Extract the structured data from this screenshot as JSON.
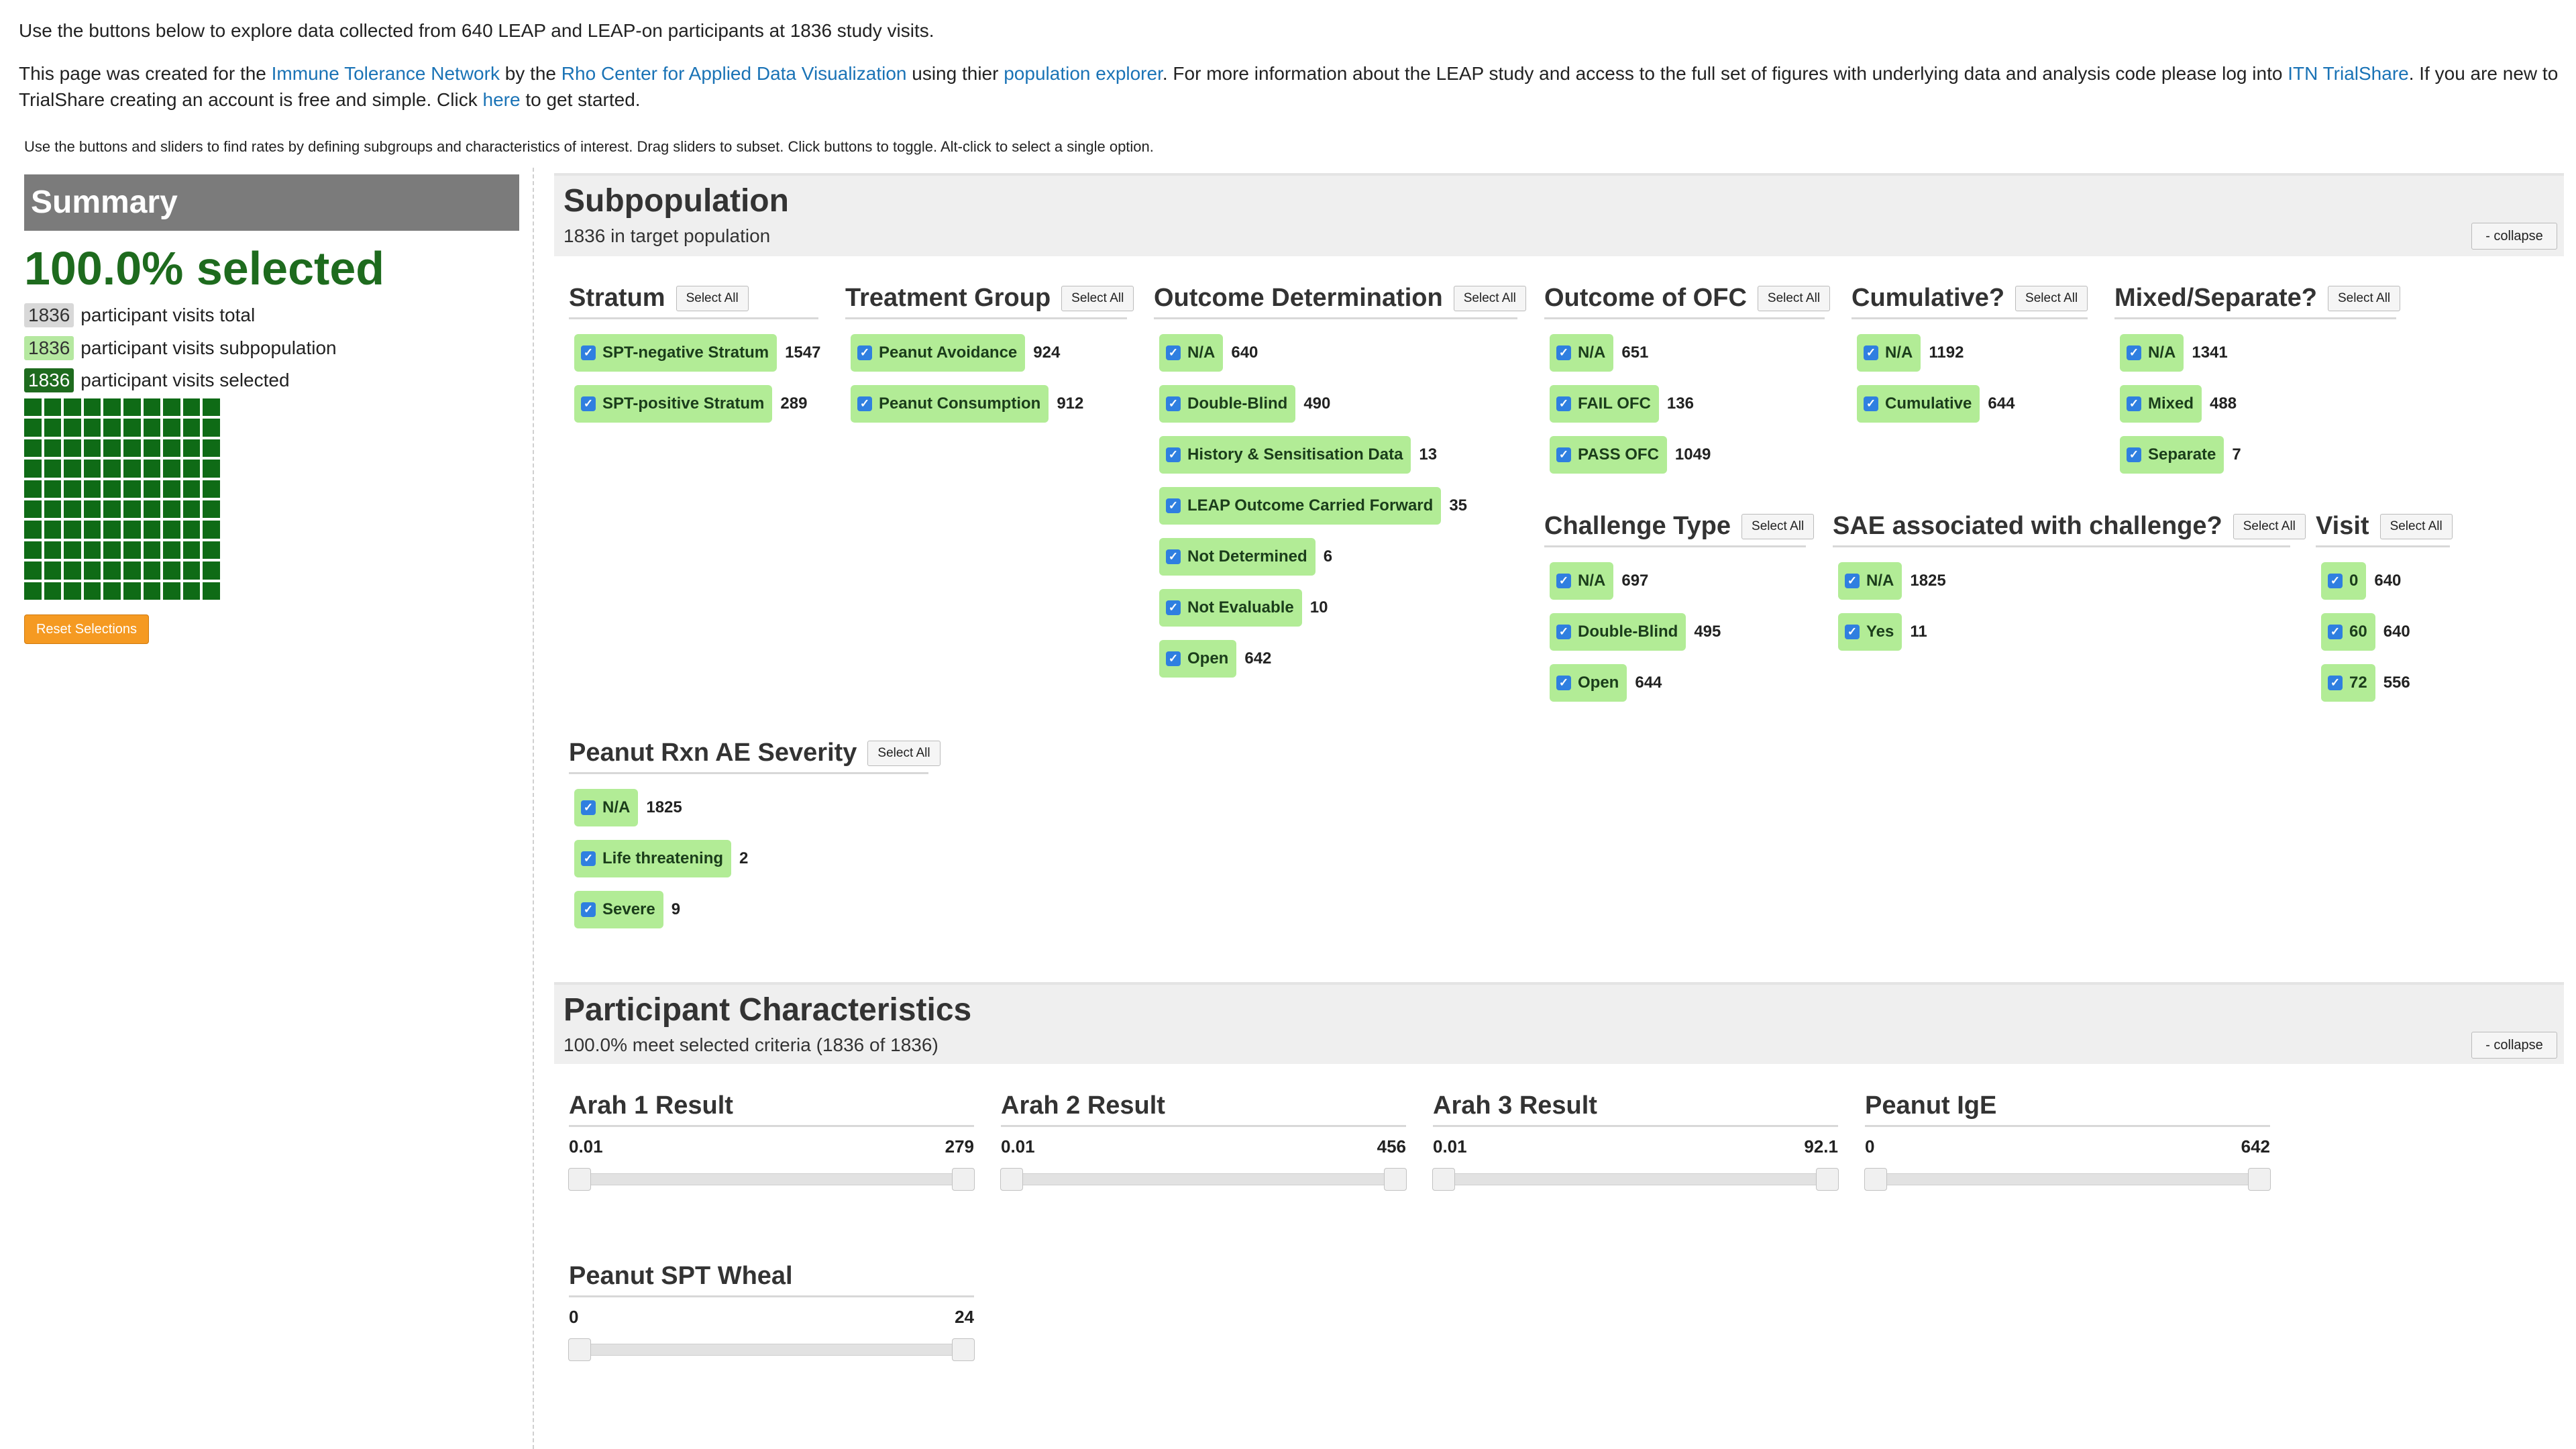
{
  "intro": {
    "line1": "Use the buttons below to explore data collected from 640 LEAP and LEAP-on participants at 1836 study visits.",
    "p2_a": "This page was created for the ",
    "link_itn": "Immune Tolerance Network",
    "p2_b": " by the ",
    "link_rho": "Rho Center for Applied Data Visualization",
    "p2_c": " using thier ",
    "link_pe": "population explorer",
    "p2_d": ". For more information about the LEAP study and access to the full set of figures with underlying data and analysis code please log into ",
    "link_trialshare": "ITN TrialShare",
    "p2_e": ". If you are new to TrialShare creating an account is free and simple. Click ",
    "link_here": "here",
    "p2_f": " to get started.",
    "instructions": "Use the buttons and sliders to find rates by defining subgroups and characteristics of interest. Drag sliders to subset. Click buttons to toggle. Alt-click to select a single option."
  },
  "summary": {
    "title": "Summary",
    "pct_selected": "100.0% selected",
    "total_count": "1836",
    "total_label": "participant visits total",
    "sub_count": "1836",
    "sub_label": "participant visits subpopulation",
    "sel_count": "1836",
    "sel_label": "participant visits selected",
    "reset_label": "Reset Selections",
    "colors": {
      "selected": "#0f6b16",
      "subpopulation": "#b5e8a0",
      "reset": "#f59a22"
    }
  },
  "subpopulation": {
    "title": "Subpopulation",
    "subtitle": "1836 in target population",
    "collapse_label": "- collapse",
    "select_all_label": "Select All",
    "groups": {
      "stratum": {
        "title": "Stratum",
        "options": [
          {
            "label": "SPT-negative Stratum",
            "count": "1547"
          },
          {
            "label": "SPT-positive Stratum",
            "count": "289"
          }
        ]
      },
      "treatment": {
        "title": "Treatment Group",
        "options": [
          {
            "label": "Peanut Avoidance",
            "count": "924"
          },
          {
            "label": "Peanut Consumption",
            "count": "912"
          }
        ]
      },
      "outcome_det": {
        "title": "Outcome Determination",
        "options": [
          {
            "label": "N/A",
            "count": "640"
          },
          {
            "label": "Double-Blind",
            "count": "490"
          },
          {
            "label": "History & Sensitisation Data",
            "count": "13"
          },
          {
            "label": "LEAP Outcome Carried Forward",
            "count": "35"
          },
          {
            "label": "Not Determined",
            "count": "6"
          },
          {
            "label": "Not Evaluable",
            "count": "10"
          },
          {
            "label": "Open",
            "count": "642"
          }
        ]
      },
      "outcome_ofc": {
        "title": "Outcome of OFC",
        "options": [
          {
            "label": "N/A",
            "count": "651"
          },
          {
            "label": "FAIL OFC",
            "count": "136"
          },
          {
            "label": "PASS OFC",
            "count": "1049"
          }
        ]
      },
      "cumulative": {
        "title": "Cumulative?",
        "options": [
          {
            "label": "N/A",
            "count": "1192"
          },
          {
            "label": "Cumulative",
            "count": "644"
          }
        ]
      },
      "mixed": {
        "title": "Mixed/Separate?",
        "options": [
          {
            "label": "N/A",
            "count": "1341"
          },
          {
            "label": "Mixed",
            "count": "488"
          },
          {
            "label": "Separate",
            "count": "7"
          }
        ]
      },
      "challenge": {
        "title": "Challenge Type",
        "options": [
          {
            "label": "N/A",
            "count": "697"
          },
          {
            "label": "Double-Blind",
            "count": "495"
          },
          {
            "label": "Open",
            "count": "644"
          }
        ]
      },
      "sae": {
        "title": "SAE associated with challenge?",
        "options": [
          {
            "label": "N/A",
            "count": "1825"
          },
          {
            "label": "Yes",
            "count": "11"
          }
        ]
      },
      "visit": {
        "title": "Visit",
        "options": [
          {
            "label": "0",
            "count": "640"
          },
          {
            "label": "60",
            "count": "640"
          },
          {
            "label": "72",
            "count": "556"
          }
        ]
      },
      "severity": {
        "title": "Peanut Rxn AE Severity",
        "options": [
          {
            "label": "N/A",
            "count": "1825"
          },
          {
            "label": "Life threatening",
            "count": "2"
          },
          {
            "label": "Severe",
            "count": "9"
          }
        ]
      }
    }
  },
  "characteristics": {
    "title": "Participant Characteristics",
    "subtitle": "100.0% meet selected criteria (1836 of 1836)",
    "collapse_label": "- collapse",
    "sliders": {
      "arah1": {
        "title": "Arah 1 Result",
        "min": "0.01",
        "max": "279"
      },
      "arah2": {
        "title": "Arah 2 Result",
        "min": "0.01",
        "max": "456"
      },
      "arah3": {
        "title": "Arah 3 Result",
        "min": "0.01",
        "max": "92.1"
      },
      "ige": {
        "title": "Peanut IgE",
        "min": "0",
        "max": "642"
      },
      "spt": {
        "title": "Peanut SPT Wheal",
        "min": "0",
        "max": "24"
      }
    }
  }
}
